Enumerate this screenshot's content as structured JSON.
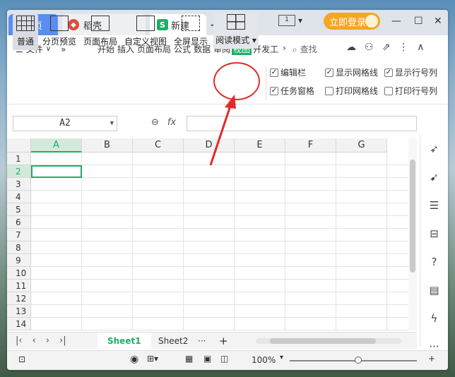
{
  "tabs": {
    "home": "首页",
    "daoke": "稻壳",
    "new_doc": "新建"
  },
  "titlebar": {
    "login": "立即登录",
    "screen_icon": "1"
  },
  "menu": {
    "file": "文件",
    "tabs": [
      "开始",
      "插入",
      "页面布局",
      "公式",
      "数据",
      "审阅",
      "视图",
      "开发工"
    ],
    "active_tab": "视图",
    "search": "查找"
  },
  "ribbon": {
    "normal": "普通",
    "page_break_preview": "分页预览",
    "page_layout": "页面布局",
    "custom_view": "自定义视图",
    "fullscreen": "全屏显示",
    "reading_mode": "阅读模式",
    "checks": [
      {
        "label": "编辑栏",
        "checked": true
      },
      {
        "label": "显示网格线",
        "checked": true
      },
      {
        "label": "显示行号列",
        "checked": true
      },
      {
        "label": "任务窗格",
        "checked": true
      },
      {
        "label": "打印网格线",
        "checked": false
      },
      {
        "label": "打印行号列",
        "checked": false
      }
    ]
  },
  "formula_bar": {
    "cell_ref": "A2",
    "fx": "fx"
  },
  "grid": {
    "columns": [
      "A",
      "B",
      "C",
      "D",
      "E",
      "F",
      "G"
    ],
    "rows": [
      "1",
      "2",
      "3",
      "4",
      "5",
      "6",
      "7",
      "8",
      "9",
      "10",
      "11",
      "12",
      "13",
      "14"
    ],
    "active_cell": "A2"
  },
  "sheets": {
    "tabs": [
      "Sheet1",
      "Sheet2"
    ],
    "active": "Sheet1",
    "more": "···",
    "add": "+"
  },
  "status": {
    "zoom": "100%"
  },
  "colors": {
    "accent_green": "#1fae66",
    "home_tab_blue": "#5b8def",
    "login_orange": "#f5a623",
    "annotation_red": "#e12b2b"
  },
  "icons": [
    "home-tab",
    "daoke-logo",
    "sheet-s-logo",
    "screen-icon",
    "avatar",
    "minimize-icon",
    "maximize-icon",
    "close-icon",
    "menu-icon",
    "search-icon",
    "cloud-sync-icon",
    "user-add-icon",
    "share-icon",
    "collapse-icon",
    "grid-normal-icon",
    "zoom-icon",
    "rocket-icon",
    "pointer-icon",
    "sliders-icon",
    "help-icon",
    "eye-icon",
    "more-icon"
  ]
}
